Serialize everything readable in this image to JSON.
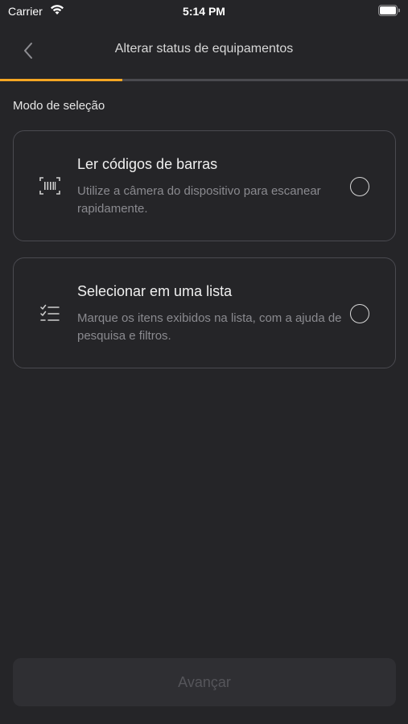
{
  "status_bar": {
    "carrier": "Carrier",
    "time": "5:14 PM"
  },
  "nav": {
    "title": "Alterar status de equipamentos",
    "back_icon": "chevron-left-icon"
  },
  "progress": {
    "value": 0.3,
    "color": "#f5a623"
  },
  "section": {
    "label": "Modo de seleção"
  },
  "options": [
    {
      "icon": "barcode-scan-icon",
      "title": "Ler códigos de barras",
      "description": "Utilize a câmera do dispositivo para escanear rapidamente.",
      "selected": false
    },
    {
      "icon": "checklist-icon",
      "title": "Selecionar em uma lista",
      "description": "Marque os itens exibidos na lista, com a ajuda de pesquisa e filtros.",
      "selected": false
    }
  ],
  "footer": {
    "next_label": "Avançar",
    "next_enabled": false
  },
  "colors": {
    "background": "#252528",
    "accent": "#f5a623",
    "card_border": "#4a4a50"
  }
}
